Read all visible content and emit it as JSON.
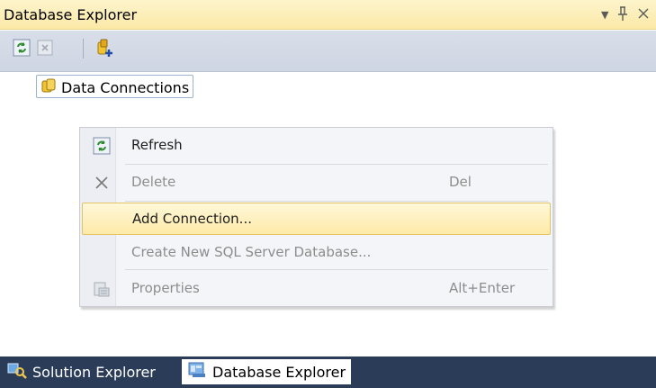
{
  "panel": {
    "title": "Database Explorer"
  },
  "title_controls": {
    "dropdown_icon": "dropdown-arrow-icon",
    "pin_icon": "pin-icon",
    "close_icon": "close-icon"
  },
  "toolbar": {
    "buttons": [
      {
        "name": "refresh",
        "icon": "refresh-icon",
        "enabled": true
      },
      {
        "name": "delete",
        "icon": "delete-icon",
        "enabled": false
      },
      {
        "name": "connect-to-database",
        "icon": "connect-database-icon",
        "enabled": true
      }
    ]
  },
  "tree": {
    "root_label": "Data Connections",
    "root_icon": "data-connections-icon"
  },
  "context_menu": {
    "items": [
      {
        "label": "Refresh",
        "shortcut": "",
        "icon": "refresh-icon",
        "enabled": true,
        "highlighted": false
      },
      {
        "label": "Delete",
        "shortcut": "Del",
        "icon": "delete-x-icon",
        "enabled": false,
        "highlighted": false
      },
      {
        "label": "Add Connection...",
        "shortcut": "",
        "icon": "",
        "enabled": true,
        "highlighted": true
      },
      {
        "label": "Create New SQL Server Database...",
        "shortcut": "",
        "icon": "",
        "enabled": false,
        "highlighted": false
      },
      {
        "label": "Properties",
        "shortcut": "Alt+Enter",
        "icon": "properties-icon",
        "enabled": false,
        "highlighted": false
      }
    ]
  },
  "bottom_tabs": [
    {
      "label": "Solution Explorer",
      "icon": "solution-explorer-icon",
      "active": false
    },
    {
      "label": "Database Explorer",
      "icon": "database-explorer-icon",
      "active": true
    }
  ],
  "colors": {
    "title_bar": "#fbe9a6",
    "toolbar": "#d3d9e6",
    "menu_highlight": "#fdeaa8",
    "tab_strip": "#2b3c59"
  }
}
